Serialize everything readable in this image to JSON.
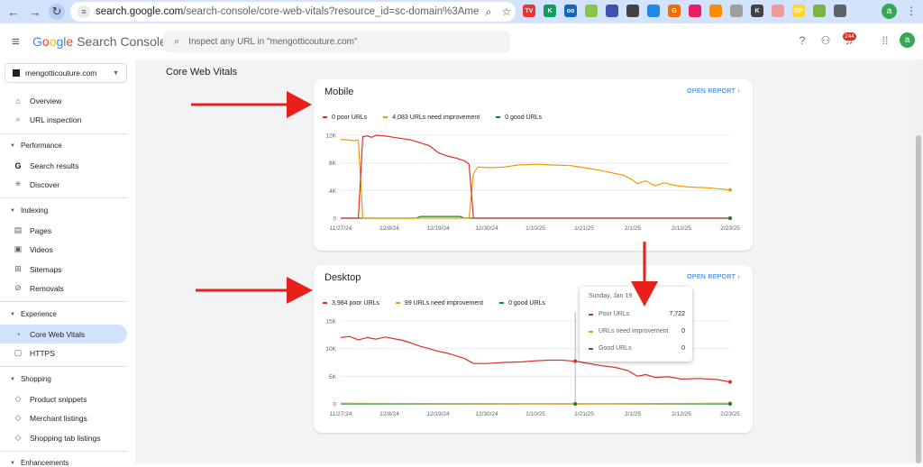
{
  "browser": {
    "url_host": "search.google.com",
    "url_path": "/search-console/core-web-vitals?resource_id=sc-domain%3Amengotticouture.c...",
    "extensions": [
      {
        "name": "tv-extension-icon",
        "label": "TV",
        "color": "#e53935"
      },
      {
        "name": "k-extension-icon",
        "label": "K",
        "color": "#0f9d58"
      },
      {
        "name": "oo-extension-icon",
        "label": "oo",
        "color": "#1565c0"
      },
      {
        "name": "grid-extension-icon",
        "label": "",
        "color": "#8bc34a"
      },
      {
        "name": "circle-extension-icon",
        "label": "",
        "color": "#3f51b5"
      },
      {
        "name": "tag-extension-icon",
        "label": "",
        "color": "#424242"
      },
      {
        "name": "diamond-extension-icon",
        "label": "",
        "color": "#1e88e5"
      },
      {
        "name": "g-extension-icon",
        "label": "G",
        "color": "#ef6c00"
      },
      {
        "name": "stats-extension-icon",
        "label": "",
        "color": "#e91e63"
      },
      {
        "name": "mail-extension-icon",
        "label": "",
        "color": "#fb8c00"
      },
      {
        "name": "a-extension-icon",
        "label": "",
        "color": "#9e9e9e"
      },
      {
        "name": "k2-extension-icon",
        "label": "K",
        "color": "#424242"
      },
      {
        "name": "plus-extension-icon",
        "label": "",
        "color": "#ef9a9a"
      },
      {
        "name": "dp-extension-icon",
        "label": "DP",
        "color": "#fdd835"
      },
      {
        "name": "check-extension-icon",
        "label": "",
        "color": "#7cb342"
      },
      {
        "name": "puzzle-extension-icon",
        "label": "",
        "color": "#5f6368"
      }
    ],
    "profile_initial": "a"
  },
  "header": {
    "logo_google": [
      "G",
      "o",
      "o",
      "g",
      "l",
      "e"
    ],
    "product": "Search Console",
    "search_placeholder": "Inspect any URL in \"mengotticouture.com\"",
    "notification_count": "244",
    "avatar_initial": "a"
  },
  "sidebar": {
    "property": "mengotticouture.com",
    "items": [
      {
        "label": "Overview",
        "icon": "home-icon",
        "glyph": "⌂"
      },
      {
        "label": "URL inspection",
        "icon": "search-icon",
        "glyph": "⌕"
      }
    ],
    "performance": {
      "title": "Performance",
      "items": [
        {
          "label": "Search results",
          "icon": "google-g-icon",
          "glyph": "G"
        },
        {
          "label": "Discover",
          "icon": "asterisk-icon",
          "glyph": "✳"
        }
      ]
    },
    "indexing": {
      "title": "Indexing",
      "items": [
        {
          "label": "Pages",
          "icon": "pages-icon",
          "glyph": "▤"
        },
        {
          "label": "Videos",
          "icon": "video-icon",
          "glyph": "▣"
        },
        {
          "label": "Sitemaps",
          "icon": "sitemap-icon",
          "glyph": "⊞"
        },
        {
          "label": "Removals",
          "icon": "removal-icon",
          "glyph": "⊘"
        }
      ]
    },
    "experience": {
      "title": "Experience",
      "items": [
        {
          "label": "Core Web Vitals",
          "icon": "speed-icon",
          "glyph": "◔"
        },
        {
          "label": "HTTPS",
          "icon": "lock-icon",
          "glyph": "▢"
        }
      ]
    },
    "shopping": {
      "title": "Shopping",
      "items": [
        {
          "label": "Product snippets",
          "icon": "diamond-icon",
          "glyph": "◇"
        },
        {
          "label": "Merchant listings",
          "icon": "diamond-icon",
          "glyph": "◇"
        },
        {
          "label": "Shopping tab listings",
          "icon": "tag-icon",
          "glyph": "◇"
        }
      ]
    },
    "enhancements": {
      "title": "Enhancements"
    }
  },
  "main": {
    "page_title": "Core Web Vitals",
    "open_report": "OPEN REPORT",
    "mobile": {
      "title": "Mobile",
      "legend": {
        "poor": "0 poor URLs",
        "ni": "4,083 URLs need improvement",
        "good": "0 good URLs"
      }
    },
    "desktop": {
      "title": "Desktop",
      "legend": {
        "poor": "3,984 poor URLs",
        "ni": "99 URLs need improvement",
        "good": "0 good URLs"
      }
    },
    "tooltip": {
      "date": "Sunday, Jan 19",
      "poor_label": "Poor URLs",
      "poor_value": "7,722",
      "ni_label": "URLs need improvement",
      "ni_value": "0",
      "good_label": "Good URLs",
      "good_value": "0"
    }
  },
  "colors": {
    "poor": "#d93025",
    "need_improvement": "#f29900",
    "good": "#188038",
    "accent": "#1a73e8",
    "annotation_arrow": "#e8201a"
  },
  "chart_data": [
    {
      "type": "line",
      "title": "Mobile",
      "x_ticks": [
        "11/27/24",
        "12/8/24",
        "12/19/24",
        "12/30/24",
        "1/10/25",
        "1/21/25",
        "2/1/25",
        "2/12/25",
        "2/23/25"
      ],
      "y_ticks": [
        "0",
        "4K",
        "8K",
        "12K"
      ],
      "ylim": [
        0,
        12000
      ],
      "xlim": [
        "2024-11-27",
        "2025-02-23"
      ],
      "grid": true,
      "series": [
        {
          "name": "poor URLs",
          "color": "#d93025",
          "points": [
            [
              "2024-11-27",
              0
            ],
            [
              "2024-12-01",
              0
            ],
            [
              "2024-12-02",
              11800
            ],
            [
              "2024-12-03",
              11900
            ],
            [
              "2024-12-04",
              11700
            ],
            [
              "2024-12-05",
              12000
            ],
            [
              "2024-12-07",
              11900
            ],
            [
              "2024-12-09",
              11700
            ],
            [
              "2024-12-11",
              11500
            ],
            [
              "2024-12-13",
              11300
            ],
            [
              "2024-12-15",
              10900
            ],
            [
              "2024-12-17",
              10500
            ],
            [
              "2024-12-19",
              9500
            ],
            [
              "2024-12-21",
              9000
            ],
            [
              "2024-12-23",
              8700
            ],
            [
              "2024-12-25",
              8300
            ],
            [
              "2024-12-26",
              7800
            ],
            [
              "2024-12-27",
              0
            ],
            [
              "2025-02-23",
              0
            ]
          ]
        },
        {
          "name": "URLs need improvement",
          "color": "#f29900",
          "points": [
            [
              "2024-11-27",
              11400
            ],
            [
              "2024-11-29",
              11300
            ],
            [
              "2024-11-30",
              11200
            ],
            [
              "2024-12-01",
              11300
            ],
            [
              "2024-12-02",
              0
            ],
            [
              "2024-12-26",
              0
            ],
            [
              "2024-12-27",
              6500
            ],
            [
              "2024-12-28",
              7400
            ],
            [
              "2024-12-31",
              7300
            ],
            [
              "2025-01-03",
              7400
            ],
            [
              "2025-01-06",
              7700
            ],
            [
              "2025-01-10",
              7800
            ],
            [
              "2025-01-14",
              7700
            ],
            [
              "2025-01-18",
              7600
            ],
            [
              "2025-01-21",
              7300
            ],
            [
              "2025-01-24",
              7000
            ],
            [
              "2025-01-27",
              6600
            ],
            [
              "2025-01-30",
              6200
            ],
            [
              "2025-02-01",
              5500
            ],
            [
              "2025-02-02",
              5000
            ],
            [
              "2025-02-04",
              5400
            ],
            [
              "2025-02-06",
              4700
            ],
            [
              "2025-02-08",
              5100
            ],
            [
              "2025-02-11",
              4700
            ],
            [
              "2025-02-14",
              4500
            ],
            [
              "2025-02-18",
              4400
            ],
            [
              "2025-02-23",
              4100
            ]
          ]
        },
        {
          "name": "good URLs",
          "color": "#188038",
          "points": [
            [
              "2024-11-27",
              0
            ],
            [
              "2024-12-14",
              0
            ],
            [
              "2024-12-15",
              250
            ],
            [
              "2024-12-24",
              250
            ],
            [
              "2024-12-25",
              0
            ],
            [
              "2025-02-23",
              0
            ]
          ]
        }
      ]
    },
    {
      "type": "line",
      "title": "Desktop",
      "x_ticks": [
        "11/27/24",
        "12/8/24",
        "12/19/24",
        "12/30/24",
        "1/10/25",
        "1/21/25",
        "2/1/25",
        "2/12/25",
        "2/23/25"
      ],
      "y_ticks": [
        "0",
        "5K",
        "10K",
        "15K"
      ],
      "ylim": [
        0,
        15000
      ],
      "xlim": [
        "2024-11-27",
        "2025-02-23"
      ],
      "grid": true,
      "series": [
        {
          "name": "poor URLs",
          "color": "#d93025",
          "points": [
            [
              "2024-11-27",
              12000
            ],
            [
              "2024-11-29",
              12200
            ],
            [
              "2024-12-01",
              11600
            ],
            [
              "2024-12-03",
              12000
            ],
            [
              "2024-12-05",
              11700
            ],
            [
              "2024-12-07",
              12100
            ],
            [
              "2024-12-09",
              11800
            ],
            [
              "2024-12-11",
              11500
            ],
            [
              "2024-12-13",
              11000
            ],
            [
              "2024-12-15",
              10400
            ],
            [
              "2024-12-17",
              10000
            ],
            [
              "2024-12-19",
              9500
            ],
            [
              "2024-12-21",
              9200
            ],
            [
              "2024-12-23",
              8700
            ],
            [
              "2024-12-25",
              8200
            ],
            [
              "2024-12-27",
              7300
            ],
            [
              "2024-12-30",
              7300
            ],
            [
              "2025-01-03",
              7500
            ],
            [
              "2025-01-07",
              7600
            ],
            [
              "2025-01-10",
              7800
            ],
            [
              "2025-01-13",
              7900
            ],
            [
              "2025-01-16",
              7900
            ],
            [
              "2025-01-19",
              7722
            ],
            [
              "2025-01-22",
              7300
            ],
            [
              "2025-01-25",
              6900
            ],
            [
              "2025-01-28",
              6600
            ],
            [
              "2025-01-31",
              6000
            ],
            [
              "2025-02-02",
              5000
            ],
            [
              "2025-02-04",
              5300
            ],
            [
              "2025-02-06",
              4800
            ],
            [
              "2025-02-09",
              4900
            ],
            [
              "2025-02-12",
              4500
            ],
            [
              "2025-02-16",
              4600
            ],
            [
              "2025-02-20",
              4400
            ],
            [
              "2025-02-23",
              3984
            ]
          ]
        },
        {
          "name": "URLs need improvement",
          "color": "#f29900",
          "points": [
            [
              "2024-11-27",
              100
            ],
            [
              "2025-01-19",
              0
            ],
            [
              "2025-02-20",
              100
            ],
            [
              "2025-02-23",
              99
            ]
          ]
        },
        {
          "name": "good URLs",
          "color": "#188038",
          "points": [
            [
              "2024-11-27",
              0
            ],
            [
              "2025-02-23",
              0
            ]
          ]
        }
      ],
      "highlight_date": "2025-01-19"
    }
  ]
}
